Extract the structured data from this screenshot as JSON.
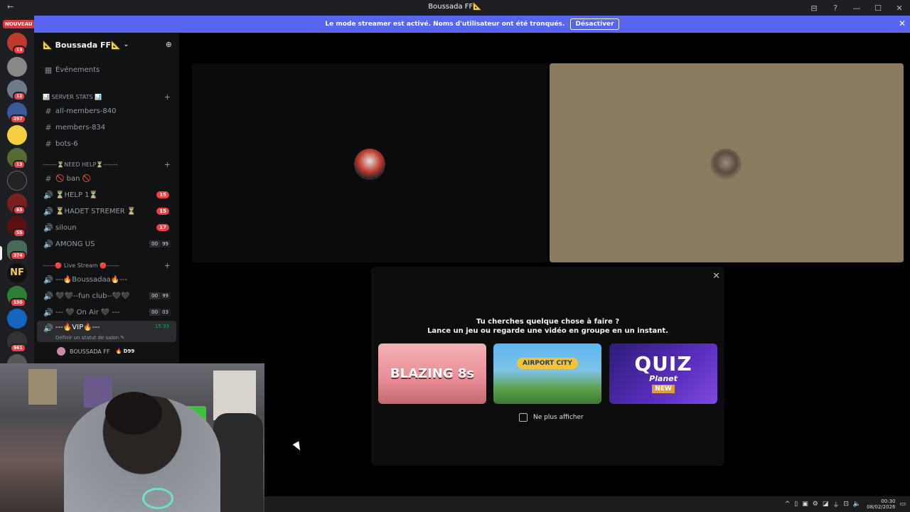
{
  "window": {
    "title": "Boussada FF📐",
    "back": "←",
    "controls": [
      "⊟",
      "?",
      "—",
      "☐",
      "✕"
    ]
  },
  "banner": {
    "text": "Le mode streamer est activé. Noms d'utilisateur ont été tronqués.",
    "button": "Désactiver",
    "close": "✕"
  },
  "rail": {
    "new_label": "NOUVEAU",
    "badges": [
      "13",
      "12",
      "297",
      "13",
      "63",
      "55",
      "374",
      "150",
      "961"
    ]
  },
  "server": {
    "name": "📐 Boussada FF📐",
    "chevron": "⌄",
    "events_label": "Événements",
    "categories": [
      {
        "label": "📊 SERVER STATS 📊"
      },
      {
        "label": "-------⏳NEED HELP⏳-------"
      },
      {
        "label": "------🔴 Live Stream 🔴------"
      }
    ],
    "channels": [
      {
        "label": "all-members-840",
        "icon": "#"
      },
      {
        "label": "members-834",
        "icon": "#"
      },
      {
        "label": "bots-6",
        "icon": "#"
      },
      {
        "label": "🚫 ban 🚫",
        "icon": "#"
      },
      {
        "label": "⏳HELP 1⏳",
        "icon": "🔊",
        "badge": "15"
      },
      {
        "label": "⏳HADET STREMER ⏳",
        "icon": "🔊",
        "badge": "15"
      },
      {
        "label": "siloun",
        "icon": "🔊",
        "badge": "17"
      },
      {
        "label": "AMONG US",
        "icon": "🔊",
        "count": [
          "00",
          "99"
        ]
      },
      {
        "label": "---🔥Boussadaa🔥---",
        "icon": "🔊"
      },
      {
        "label": "🖤🖤--fun club--🖤🖤",
        "icon": "🔊",
        "count": [
          "00",
          "99"
        ]
      },
      {
        "label": "--- 🖤 On Air 🖤 ---",
        "icon": "🔊",
        "count": [
          "00",
          "03"
        ]
      },
      {
        "label": "---🔥VIP🔥---",
        "icon": "🔊",
        "timer": "15:33"
      }
    ],
    "vip_status": "Définir un statut de salon ✎",
    "member": {
      "name": "BOUSSADA FF",
      "tag": "🔥 D99"
    }
  },
  "popup": {
    "question": "Tu cherches quelque chose à faire ?",
    "subtitle": "Lance un jeu ou regarde une vidéo en groupe en un instant.",
    "games": [
      {
        "title": "BLAZING 8s"
      },
      {
        "title": "AIRPORT CITY"
      },
      {
        "title": "QUIZ",
        "subtitle": "Planet",
        "tag": "NEW"
      }
    ],
    "checkbox_label": "Ne plus afficher",
    "close": "✕"
  },
  "taskbar": {
    "time": "00:30",
    "date": "08/02/2026"
  },
  "colors": {
    "accent": "#5865f2",
    "badge": "#f23f43",
    "online": "#23a55a"
  }
}
